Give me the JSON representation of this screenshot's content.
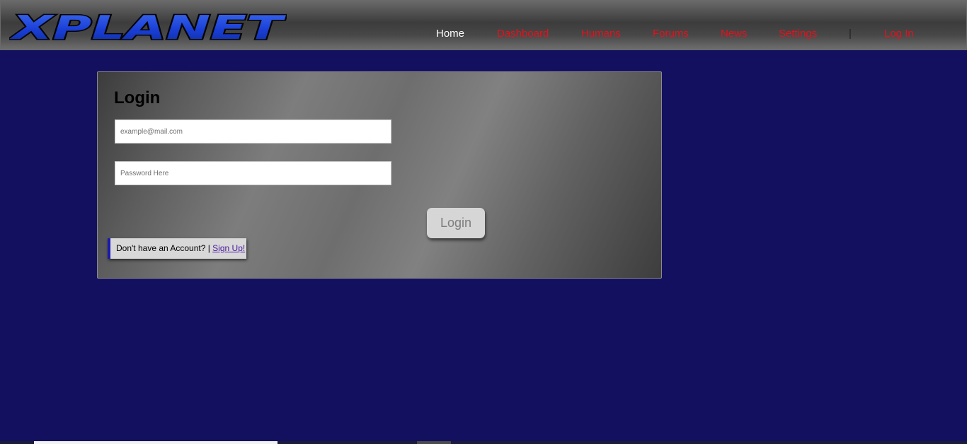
{
  "header": {
    "logo_text": "XPLANET",
    "nav": {
      "home": "Home",
      "dashboard": "Dashboard",
      "humans": "Humans",
      "forums": "Forums",
      "news": "News",
      "settings": "Settings",
      "separator": "|",
      "login": "Log In"
    }
  },
  "login_panel": {
    "title": "Login",
    "email_placeholder": "example@mail.com",
    "password_placeholder": "Password Here",
    "submit_label": "Login",
    "signup_prompt": "Don't have an Account? |",
    "signup_link": "Sign Up!"
  },
  "colors": {
    "page_background": "#13115f",
    "nav_link": "#e8101a",
    "nav_active": "#ffffff",
    "logo_fill": "#1a3fd6",
    "signup_accent": "#1a1ab0"
  },
  "icons": {
    "logo": "xplanet-logo-icon"
  }
}
